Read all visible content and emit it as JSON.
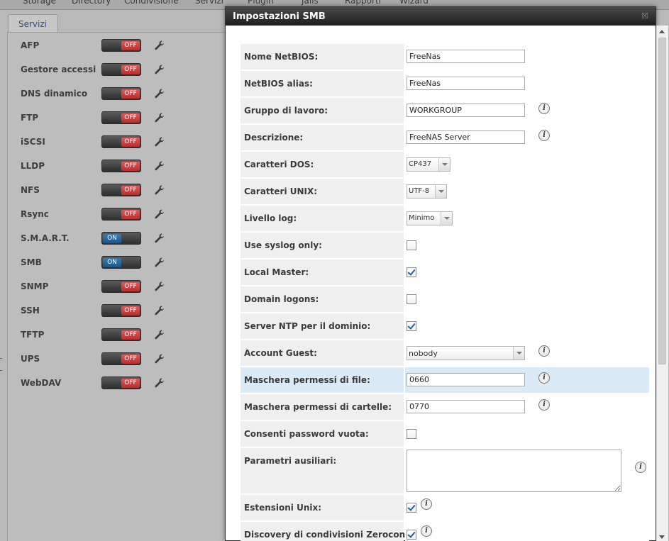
{
  "topnav": {
    "items": [
      {
        "label": "Storage"
      },
      {
        "label": "Directory"
      },
      {
        "label": "Condivisione"
      },
      {
        "label": "Servizi"
      },
      {
        "label": "Plugin"
      },
      {
        "label": "Jails"
      },
      {
        "label": "Rapporti"
      },
      {
        "label": "Wizard"
      }
    ]
  },
  "services_tab": {
    "label": "Servizi"
  },
  "services": [
    {
      "name": "AFP",
      "state": "OFF"
    },
    {
      "name": "Gestore accessi",
      "state": "OFF"
    },
    {
      "name": "DNS dinamico",
      "state": "OFF"
    },
    {
      "name": "FTP",
      "state": "OFF"
    },
    {
      "name": "iSCSI",
      "state": "OFF"
    },
    {
      "name": "LLDP",
      "state": "OFF"
    },
    {
      "name": "NFS",
      "state": "OFF"
    },
    {
      "name": "Rsync",
      "state": "OFF"
    },
    {
      "name": "S.M.A.R.T.",
      "state": "ON"
    },
    {
      "name": "SMB",
      "state": "ON"
    },
    {
      "name": "SNMP",
      "state": "OFF"
    },
    {
      "name": "SSH",
      "state": "OFF"
    },
    {
      "name": "TFTP",
      "state": "OFF"
    },
    {
      "name": "UPS",
      "state": "OFF"
    },
    {
      "name": "WebDAV",
      "state": "OFF"
    }
  ],
  "dialog": {
    "title": "Impostazioni SMB",
    "fields": {
      "netbios_name": {
        "label": "Nome NetBIOS:",
        "value": "FreeNas"
      },
      "netbios_alias": {
        "label": "NetBIOS alias:",
        "value": "FreeNas"
      },
      "workgroup": {
        "label": "Gruppo di lavoro:",
        "value": "WORKGROUP"
      },
      "description": {
        "label": "Descrizione:",
        "value": "FreeNAS Server"
      },
      "dos_charset": {
        "label": "Caratteri DOS:",
        "value": "CP437"
      },
      "unix_charset": {
        "label": "Caratteri UNIX:",
        "value": "UTF-8"
      },
      "log_level": {
        "label": "Livello log:",
        "value": "Minimo"
      },
      "syslog_only": {
        "label": "Use syslog only:",
        "checked": false
      },
      "local_master": {
        "label": "Local Master:",
        "checked": true
      },
      "domain_logons": {
        "label": "Domain logons:",
        "checked": false
      },
      "time_server": {
        "label": "Server NTP per il dominio:",
        "checked": true
      },
      "guest_account": {
        "label": "Account Guest:",
        "value": "nobody"
      },
      "file_mask": {
        "label": "Maschera permessi di file:",
        "value": "0660"
      },
      "dir_mask": {
        "label": "Maschera permessi di cartelle:",
        "value": "0770"
      },
      "null_passwords": {
        "label": "Consenti password vuota:",
        "checked": false
      },
      "aux_params": {
        "label": "Parametri ausiliari:",
        "value": ""
      },
      "unix_extensions": {
        "label": "Estensioni Unix:",
        "checked": true
      },
      "zeroconf": {
        "label": "Discovery di condivisioni Zeroconf:",
        "checked": true
      }
    },
    "info_glyph": "i",
    "close_glyph": "☒"
  }
}
